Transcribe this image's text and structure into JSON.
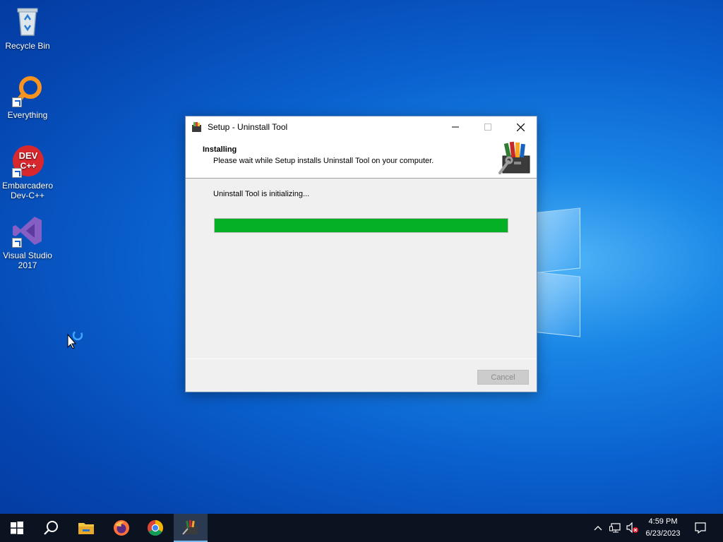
{
  "desktop": {
    "icons": [
      {
        "label": "Recycle Bin",
        "icon": "recycle-bin-icon"
      },
      {
        "label": "Everything",
        "icon": "everything-search-icon"
      },
      {
        "label": "Embarcadero Dev-C++",
        "line1": "Embarcadero",
        "line2": "Dev-C++",
        "icon": "devcpp-icon",
        "glyph_text": "DEV C++"
      },
      {
        "label": "Visual Studio 2017",
        "line1": "Visual Studio",
        "line2": "2017",
        "icon": "visual-studio-icon"
      }
    ]
  },
  "dialog": {
    "title": "Setup - Uninstall Tool",
    "header_title": "Installing",
    "header_subtitle": "Please wait while Setup installs Uninstall Tool on your computer.",
    "status": "Uninstall Tool is initializing...",
    "progress": 1.0,
    "cancel_label": "Cancel",
    "cancel_enabled": false,
    "colors": {
      "progress_fill": "#06b025"
    }
  },
  "taskbar": {
    "items": [
      "start-icon",
      "search-icon",
      "file-explorer-icon",
      "firefox-icon",
      "chrome-icon",
      "uninstall-tool-setup-icon"
    ],
    "tray_icons": [
      "chevron-up-icon",
      "network-icon",
      "volume-muted-icon"
    ],
    "time": "4:59 PM",
    "date": "6/23/2023",
    "notification_icon": "action-center-icon"
  },
  "colors": {
    "taskbar": "#0b1220",
    "desktop_accent": "#0a62cf"
  }
}
